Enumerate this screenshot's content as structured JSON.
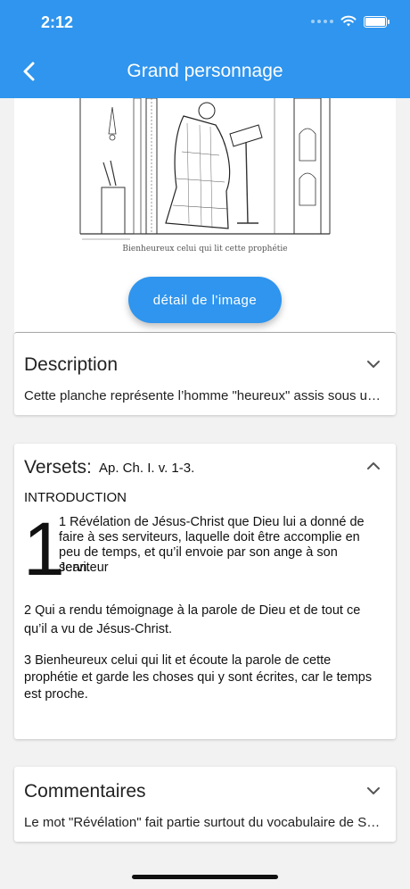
{
  "status": {
    "time": "2:12"
  },
  "header": {
    "title": "Grand personnage"
  },
  "image": {
    "caption": "Bienheureux celui qui lit cette prophétie",
    "detail_button": "détail de l'image"
  },
  "description": {
    "title": "Description",
    "preview": "Cette planche représente l’homme \"heureux\" assis sous une ..."
  },
  "versets": {
    "title": "Versets:",
    "reference": "Ap. Ch. I. v. 1-3.",
    "intro": "INTRODUCTION",
    "chapter_number": "1",
    "verse1_a": "1 Révélation de Jésus-Christ que Dieu lui a donné de faire à ses serviteurs, laquelle doit être accomplie en peu de temps, et qu’il envoie par son ange à son serviteur",
    "verse1_b": "Jean.",
    "verse2": "2 Qui a rendu témoignage à la parole de Dieu et de tout ce qu’il a vu de Jésus-Christ.",
    "verse3": "3 Bienheureux celui qui lit et écoute la parole de cette prophétie et garde les choses qui y sont écrites, car le temps est proche."
  },
  "commentaires": {
    "title": "Commentaires",
    "preview": "Le mot \"Révélation\" fait partie surtout du vocabulaire de Saint..."
  },
  "colors": {
    "primary": "#2f95ee",
    "background": "#f2f2f2"
  },
  "icons": [
    "back-arrow-icon",
    "wifi-icon",
    "battery-icon",
    "chevron-down-icon",
    "chevron-up-icon"
  ]
}
